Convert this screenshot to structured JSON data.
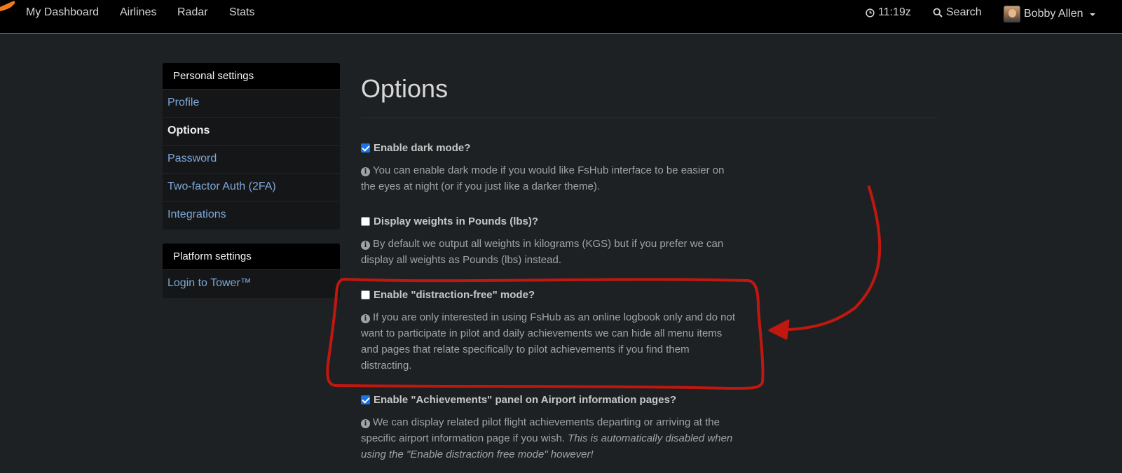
{
  "nav": {
    "items": [
      "My Dashboard",
      "Airlines",
      "Radar",
      "Stats"
    ],
    "clock": "11:19z",
    "search_label": "Search",
    "user_name": "Bobby Allen"
  },
  "sidebar": {
    "personal_heading": "Personal settings",
    "personal_items": [
      "Profile",
      "Options",
      "Password",
      "Two-factor Auth (2FA)",
      "Integrations"
    ],
    "active_item": "Options",
    "platform_heading": "Platform settings",
    "platform_items": [
      "Login to Tower™"
    ]
  },
  "main": {
    "title": "Options",
    "options": [
      {
        "label": "Enable dark mode?",
        "checked": true,
        "help": "You can enable dark mode if you would like FsHub interface to be easier on the eyes at night (or if you just like a darker theme)."
      },
      {
        "label": "Display weights in Pounds (lbs)?",
        "checked": false,
        "help": "By default we output all weights in kilograms (KGS) but if you prefer we can display all weights as Pounds (lbs) instead."
      },
      {
        "label": "Enable \"distraction-free\" mode?",
        "checked": false,
        "help": "If you are only interested in using FsHub as an online logbook only and do not want to participate in pilot and daily achievements we can hide all menu items and pages that relate specifically to pilot achievements if you find them distracting."
      },
      {
        "label": "Enable \"Achievements\" panel on Airport information pages?",
        "checked": true,
        "help": "We can display related pilot flight achievements departing or arriving at the specific airport information page if you wish.",
        "help_italic": "This is automatically disabled when using the \"Enable distraction free mode\" however!"
      }
    ]
  },
  "colors": {
    "background": "#1e2124",
    "navbar": "#000000",
    "accent": "#d9531e",
    "link": "#7ea7d8",
    "annotation": "#c0180f"
  }
}
